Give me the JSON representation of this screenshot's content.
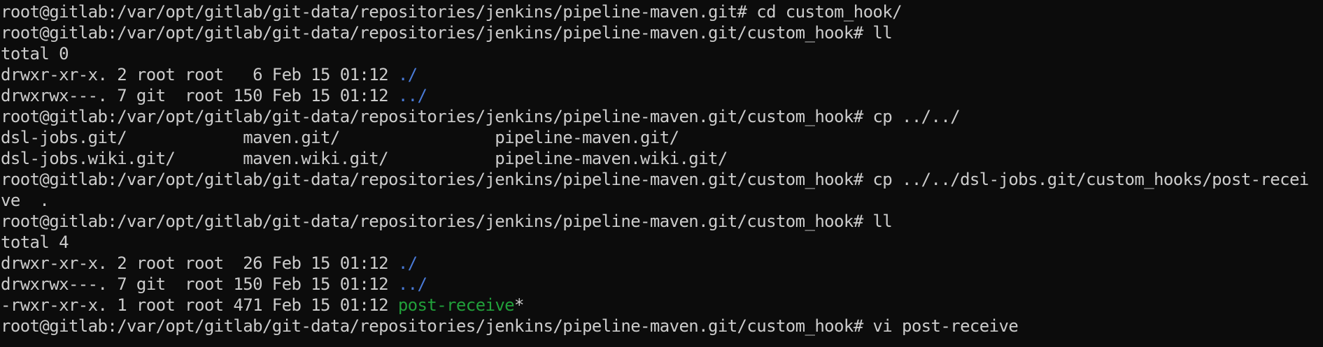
{
  "terminal": {
    "colors": {
      "background": "#0c0c0c",
      "foreground": "#cccccc",
      "directory": "#4a7bd8",
      "executable": "#21a03a"
    },
    "lines": [
      {
        "kind": "prompt",
        "segments": [
          {
            "text": "root@gitlab:/var/opt/gitlab/git-data/repositories/jenkins/pipeline-maven.git# cd custom_hook/"
          }
        ]
      },
      {
        "kind": "prompt",
        "segments": [
          {
            "text": "root@gitlab:/var/opt/gitlab/git-data/repositories/jenkins/pipeline-maven.git/custom_hook# ll"
          }
        ]
      },
      {
        "kind": "output",
        "segments": [
          {
            "text": "total 0"
          }
        ]
      },
      {
        "kind": "output",
        "segments": [
          {
            "text": "drwxr-xr-x. 2 root root   6 Feb 15 01:12 "
          },
          {
            "text": "./",
            "style": "dir"
          }
        ]
      },
      {
        "kind": "output",
        "segments": [
          {
            "text": "drwxrwx---. 7 git  root 150 Feb 15 01:12 "
          },
          {
            "text": "../",
            "style": "dir"
          }
        ]
      },
      {
        "kind": "prompt",
        "segments": [
          {
            "text": "root@gitlab:/var/opt/gitlab/git-data/repositories/jenkins/pipeline-maven.git/custom_hook# cp ../../"
          }
        ]
      },
      {
        "kind": "output",
        "segments": [
          {
            "text": "dsl-jobs.git/            maven.git/                pipeline-maven.git/"
          }
        ]
      },
      {
        "kind": "output",
        "segments": [
          {
            "text": "dsl-jobs.wiki.git/       maven.wiki.git/           pipeline-maven.wiki.git/"
          }
        ]
      },
      {
        "kind": "prompt",
        "segments": [
          {
            "text": "root@gitlab:/var/opt/gitlab/git-data/repositories/jenkins/pipeline-maven.git/custom_hook# cp ../../dsl-jobs.git/custom_hooks/post-recei"
          }
        ]
      },
      {
        "kind": "output",
        "segments": [
          {
            "text": "ve  ."
          }
        ]
      },
      {
        "kind": "prompt",
        "segments": [
          {
            "text": "root@gitlab:/var/opt/gitlab/git-data/repositories/jenkins/pipeline-maven.git/custom_hook# ll"
          }
        ]
      },
      {
        "kind": "output",
        "segments": [
          {
            "text": "total 4"
          }
        ]
      },
      {
        "kind": "output",
        "segments": [
          {
            "text": "drwxr-xr-x. 2 root root  26 Feb 15 01:12 "
          },
          {
            "text": "./",
            "style": "dir"
          }
        ]
      },
      {
        "kind": "output",
        "segments": [
          {
            "text": "drwxrwx---. 7 git  root 150 Feb 15 01:12 "
          },
          {
            "text": "../",
            "style": "dir"
          }
        ]
      },
      {
        "kind": "output",
        "segments": [
          {
            "text": "-rwxr-xr-x. 1 root root 471 Feb 15 01:12 "
          },
          {
            "text": "post-receive",
            "style": "exec"
          },
          {
            "text": "*"
          }
        ]
      },
      {
        "kind": "prompt",
        "segments": [
          {
            "text": "root@gitlab:/var/opt/gitlab/git-data/repositories/jenkins/pipeline-maven.git/custom_hook# vi post-receive"
          }
        ]
      }
    ]
  }
}
